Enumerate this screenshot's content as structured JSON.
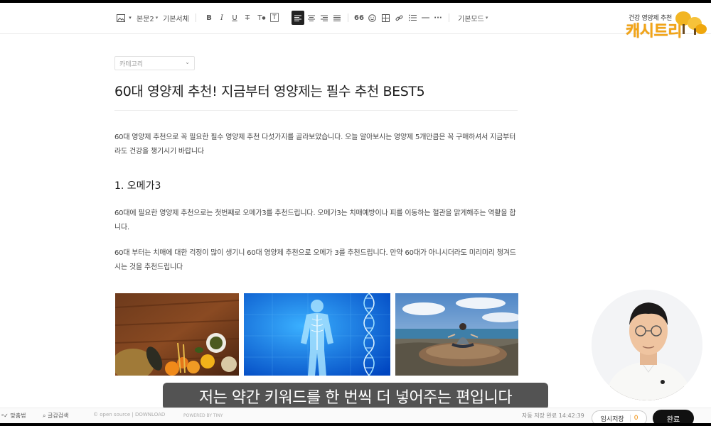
{
  "toolbar": {
    "style": "본문2",
    "font": "기본서체",
    "mode": "기본모드"
  },
  "logo": {
    "sub": "건강 영양제 추천",
    "main": "캐시트리"
  },
  "editor": {
    "category": "카테고리",
    "title": "60대 영양제 추천! 지금부터 영양제는 필수 추천 BEST5",
    "intro": "60대 영양제 추천으로 꼭 필요한 필수 영양제 추천 다섯가지를 골라보았습니다. 오늘 알아보시는 영양제 5개만큼은 꼭 구매하셔서 지금부터라도 건강을 챙기시기 바랍니다",
    "heading1": "1. 오메가3",
    "para1": "60대에 필요한 영양제 추천으로는 첫번째로 오메가3를 추천드립니다. 오메가3는 치매예방이나 피를 이동하는 혈관을 맑게해주는 역활을 합니다.",
    "para2": "60대 부터는 치매에 대한 걱정이 많이 생기니 60대 영양제 추천으로 오메가 3를 추천드립니다. 만약 60대가 아니시더라도 미리미리 챙겨드시는 것을 추천드립니다"
  },
  "caption": "저는 약간 키워드를 한 번씩 더 넣어주는 편입니다",
  "footer": {
    "spell": "맞춤법",
    "search": "글감검색",
    "opensource": "open source | DOWNLOAD",
    "powered": "POWERED BY TINY",
    "autosave": "자동 저장 완료 14:42:39",
    "temp_save": "임시저장",
    "temp_count": "0",
    "done": "완료"
  }
}
